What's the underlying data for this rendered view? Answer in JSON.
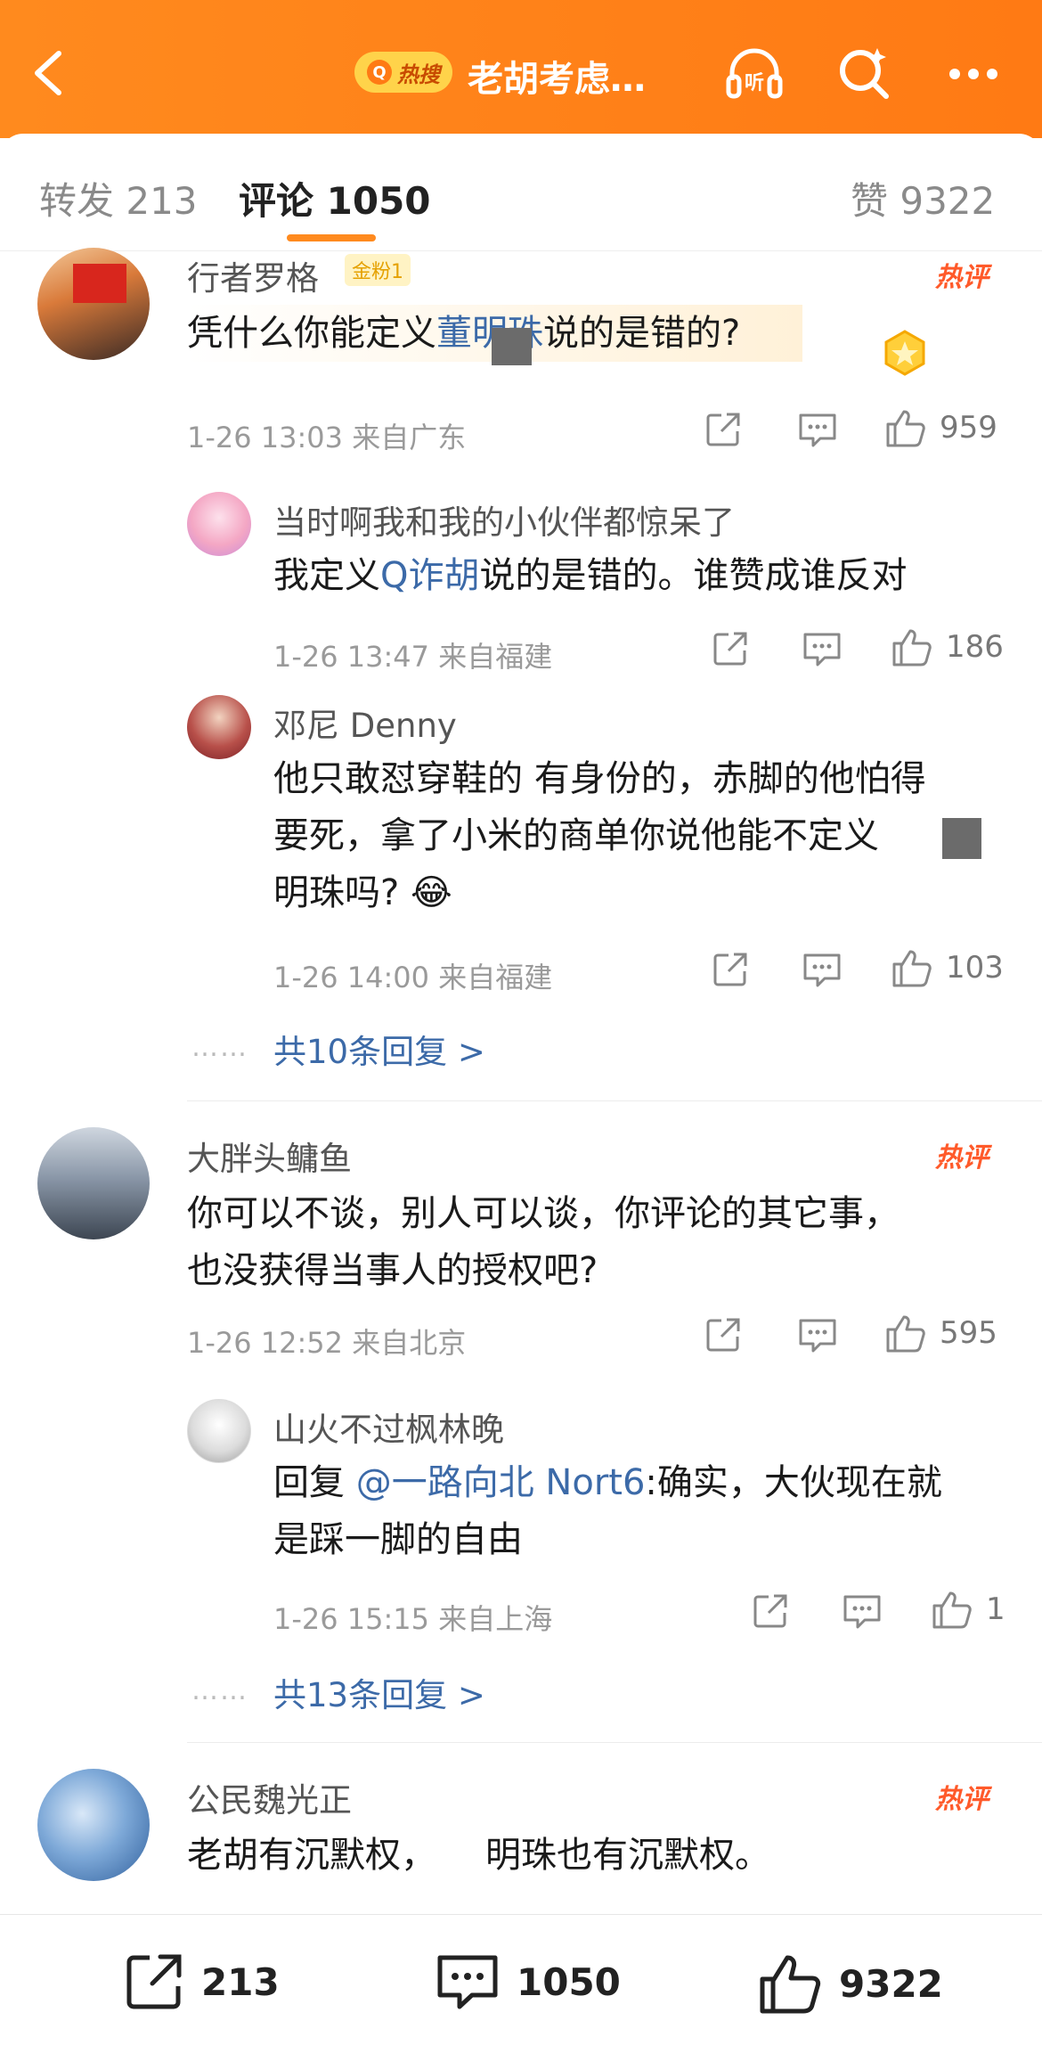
{
  "header": {
    "hot_search_label": "热搜",
    "title": "老胡考虑…",
    "listen_label": "听"
  },
  "tabs": {
    "repost": "转发 213",
    "comments": "评论 1050",
    "likes": "赞 9322"
  },
  "colors": {
    "accent": "#ff7a14",
    "link": "#3c6aa8",
    "hot": "#ff5a2a"
  },
  "comments": [
    {
      "user": "行者罗格",
      "badge": "金粉1",
      "hot_label": "热评",
      "text_a": "凭什么你能定义",
      "text_link": "董明珠",
      "text_b": "说的是错的?",
      "meta": "1-26 13:03 来自广东",
      "likes": "959",
      "replies": [
        {
          "user": "当时啊我和我的小伙伴都惊呆了",
          "text_a": "我定义",
          "text_link": "Q诈胡",
          "text_b": "说的是错的。谁赞成谁反对",
          "meta": "1-26 13:47 来自福建",
          "likes": "186"
        },
        {
          "user": "邓尼 Denny",
          "line1": "他只敢怼穿鞋的 有身份的，赤脚的他怕得",
          "line2": "要死，拿了小米的商单你说他能不定义",
          "line3": "明珠吗?",
          "emoji": "😂",
          "meta": "1-26 14:00 来自福建",
          "likes": "103"
        }
      ],
      "more_replies": "共10条回复 >"
    },
    {
      "user": "大胖头鳙鱼",
      "hot_label": "热评",
      "line1": "你可以不谈，别人可以谈，你评论的其它事，",
      "line2": "也没获得当事人的授权吧?",
      "meta": "1-26 12:52 来自北京",
      "likes": "595",
      "replies": [
        {
          "user": "山火不过枫林晚",
          "prefix": "回复 ",
          "mention": "@一路向北 Nort6",
          "line1_rest": ":确实，大伙现在就",
          "line2": "是踩一脚的自由",
          "meta": "1-26 15:15 来自上海",
          "likes": "1"
        }
      ],
      "more_replies": "共13条回复 >"
    },
    {
      "user": "公民魏光正",
      "hot_label": "热评",
      "text_a": "老胡有沉默权，",
      "text_b": "明珠也有沉默权。"
    }
  ],
  "dots_label": "……",
  "bottom_bar": {
    "repost": "213",
    "comments": "1050",
    "likes": "9322"
  }
}
